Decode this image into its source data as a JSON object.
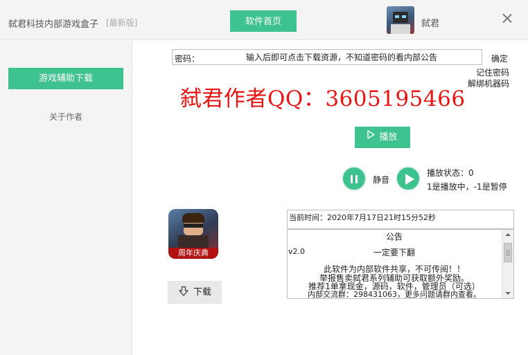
{
  "titlebar": {
    "app_title": "弑君科技内部游戏盒子",
    "badge": "[最新版]",
    "home_button": "软件首页",
    "username": "弑君"
  },
  "sidebar": {
    "items": [
      {
        "label": "游戏辅助下载",
        "active": true
      },
      {
        "label": "关于作者",
        "active": false
      }
    ]
  },
  "password": {
    "label": "密码：",
    "placeholder": "输入后即可点击下载资源，不知道密码的看内部公告",
    "confirm": "确定",
    "remember": "记住密码",
    "unbind": "解绑机器码"
  },
  "author": {
    "qq_text": "弑君作者QQ：3605195466",
    "color": "#e81414"
  },
  "player": {
    "play_button": "播放",
    "mute_label": "静音",
    "status_label": "播放状态：0",
    "status_hint": "1是播放中，-1是暂停"
  },
  "game": {
    "icon_banner": "周年庆典",
    "download_button": "下载"
  },
  "clock": {
    "text": "当前时间：2020年7月17日21时15分52秒"
  },
  "notice": {
    "title": "公告",
    "dots": "·  ·",
    "version": "v2.0",
    "line_scroll": "一定要下翻",
    "line1": "此软件为内部软件共享，不可传阅！！",
    "line2": "举报售卖弑君系列辅助可获取额外奖励。",
    "line3": "推荐1单拿现金，源码，软件，管理员（可选）",
    "line4": "内部交流群：298431063，更多问题请群内查看。"
  },
  "colors": {
    "accent": "#3ec28f",
    "sidebar_bg": "#f4f4f4"
  },
  "icons": [
    "user-avatar-icon",
    "close-icon",
    "play-icon",
    "pause-icon",
    "download-icon",
    "scroll-up-icon",
    "scroll-down-icon"
  ]
}
